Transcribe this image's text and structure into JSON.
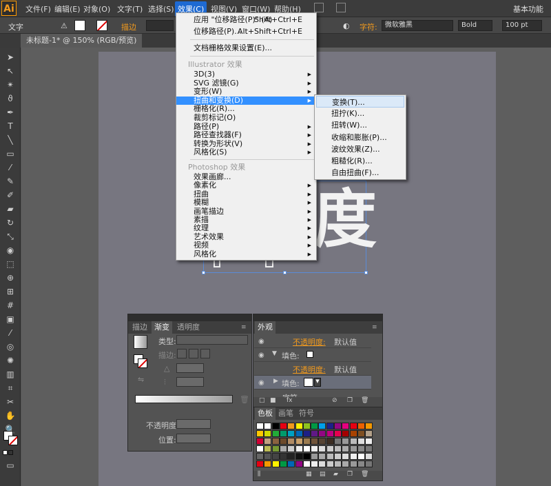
{
  "app": {
    "logo": "Ai",
    "workspace": "基本功能"
  },
  "menubar": [
    "文件(F)",
    "编辑(E)",
    "对象(O)",
    "文字(T)",
    "选择(S)",
    "效果(C)",
    "视图(V)",
    "窗口(W)",
    "帮助(H)"
  ],
  "controlbar": {
    "mode": "文字",
    "stroke_label": "描边",
    "char_label": "字符:",
    "font": "微软雅黑",
    "weight": "Bold",
    "size": "100 pt"
  },
  "document_tab": "未标题-1* @ 150% (RGB/预览)",
  "canvas": {
    "partial_char": "度"
  },
  "effect_menu": {
    "apply_last": "应用 \"位移路径(P)\" (A)",
    "apply_last_shortcut": "Shift+Ctrl+E",
    "last_effect": "位移路径(P)...",
    "last_effect_shortcut": "Alt+Shift+Ctrl+E",
    "doc_raster": "文档栅格效果设置(E)...",
    "illustrator_header": "Illustrator 效果",
    "illustrator_items": [
      "3D(3)",
      "SVG 滤镜(G)",
      "变形(W)",
      "扭曲和变换(D)",
      "栅格化(R)...",
      "裁剪标记(O)",
      "路径(P)",
      "路径查找器(F)",
      "转换为形状(V)",
      "风格化(S)"
    ],
    "photoshop_header": "Photoshop 效果",
    "photoshop_items": [
      "效果画廊...",
      "像素化",
      "扭曲",
      "模糊",
      "画笔描边",
      "素描",
      "纹理",
      "艺术效果",
      "视频",
      "风格化"
    ]
  },
  "distort_submenu": [
    "变换(T)...",
    "扭拧(K)...",
    "扭转(W)...",
    "收缩和膨胀(P)...",
    "波纹效果(Z)...",
    "粗糙化(R)...",
    "自由扭曲(F)..."
  ],
  "gradient_panel": {
    "tabs": [
      "描边",
      "渐变",
      "透明度"
    ],
    "type_label": "类型:",
    "stroke_label": "描边:",
    "opacity_label": "不透明度:",
    "position_label": "位置:"
  },
  "appearance_panel": {
    "tab": "外观",
    "opacity1": "不透明度:",
    "opacity1_value": "默认值",
    "fill1": "填色:",
    "opacity2": "不透明度:",
    "opacity2_value": "默认值",
    "fill2": "填色:",
    "char": "字符"
  },
  "swatches_panel": {
    "tabs": [
      "色板",
      "画笔",
      "符号"
    ]
  },
  "colors": {
    "accent": "#f29a1d",
    "menu_highlight": "#3390ff"
  }
}
